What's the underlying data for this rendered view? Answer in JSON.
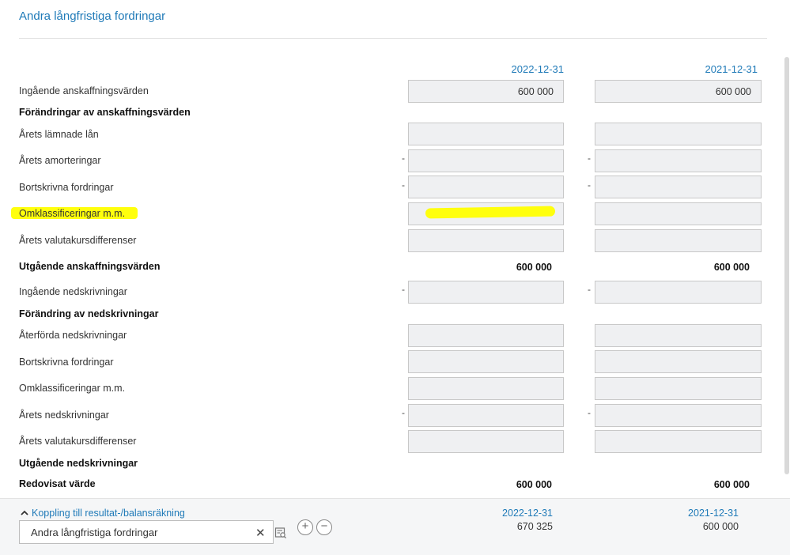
{
  "header": {
    "title": "Andra långfristiga fordringar"
  },
  "columns": {
    "col1": "2022-12-31",
    "col2": "2021-12-31"
  },
  "rows": {
    "r1": {
      "label": "Ingående anskaffningsvärden",
      "v1": "600 000",
      "v2": "600 000"
    },
    "r2": {
      "label": "Förändringar av anskaffningsvärden"
    },
    "r3": {
      "label": "Årets lämnade lån",
      "v1": "",
      "v2": ""
    },
    "r4": {
      "label": "Årets amorteringar",
      "sign": "-",
      "v1": "",
      "v2": ""
    },
    "r5": {
      "label": "Bortskrivna fordringar",
      "sign": "-",
      "v1": "",
      "v2": ""
    },
    "r6": {
      "label": "Omklassificeringar m.m.",
      "v1": "",
      "v2": ""
    },
    "r7": {
      "label": "Årets valutakursdifferenser",
      "v1": "",
      "v2": ""
    },
    "r8": {
      "label": "Utgående anskaffningsvärden",
      "t1": "600 000",
      "t2": "600 000"
    },
    "r9": {
      "label": "Ingående nedskrivningar",
      "sign": "-",
      "v1": "",
      "v2": ""
    },
    "r10": {
      "label": "Förändring av nedskrivningar"
    },
    "r11": {
      "label": "Återförda nedskrivningar",
      "v1": "",
      "v2": ""
    },
    "r12": {
      "label": "Bortskrivna fordringar",
      "v1": "",
      "v2": ""
    },
    "r13": {
      "label": "Omklassificeringar m.m.",
      "v1": "",
      "v2": ""
    },
    "r14": {
      "label": "Årets nedskrivningar",
      "sign": "-",
      "v1": "",
      "v2": ""
    },
    "r15": {
      "label": "Årets valutakursdifferenser",
      "v1": "",
      "v2": ""
    },
    "r16": {
      "label": "Utgående nedskrivningar"
    },
    "r17": {
      "label": "Redovisat värde",
      "t1": "600 000",
      "t2": "600 000"
    }
  },
  "footer": {
    "link_label": "Koppling till resultat-/balansräkning",
    "select_value": "Andra långfristiga fordringar",
    "add_glyph": "+",
    "remove_glyph": "−",
    "clear_glyph": "✕",
    "col1_date": "2022-12-31",
    "col1_value": "670 325",
    "col2_date": "2021-12-31",
    "col2_value": "600 000"
  },
  "highlight_color": "#ffff00",
  "accent_color": "#1f7ab8"
}
